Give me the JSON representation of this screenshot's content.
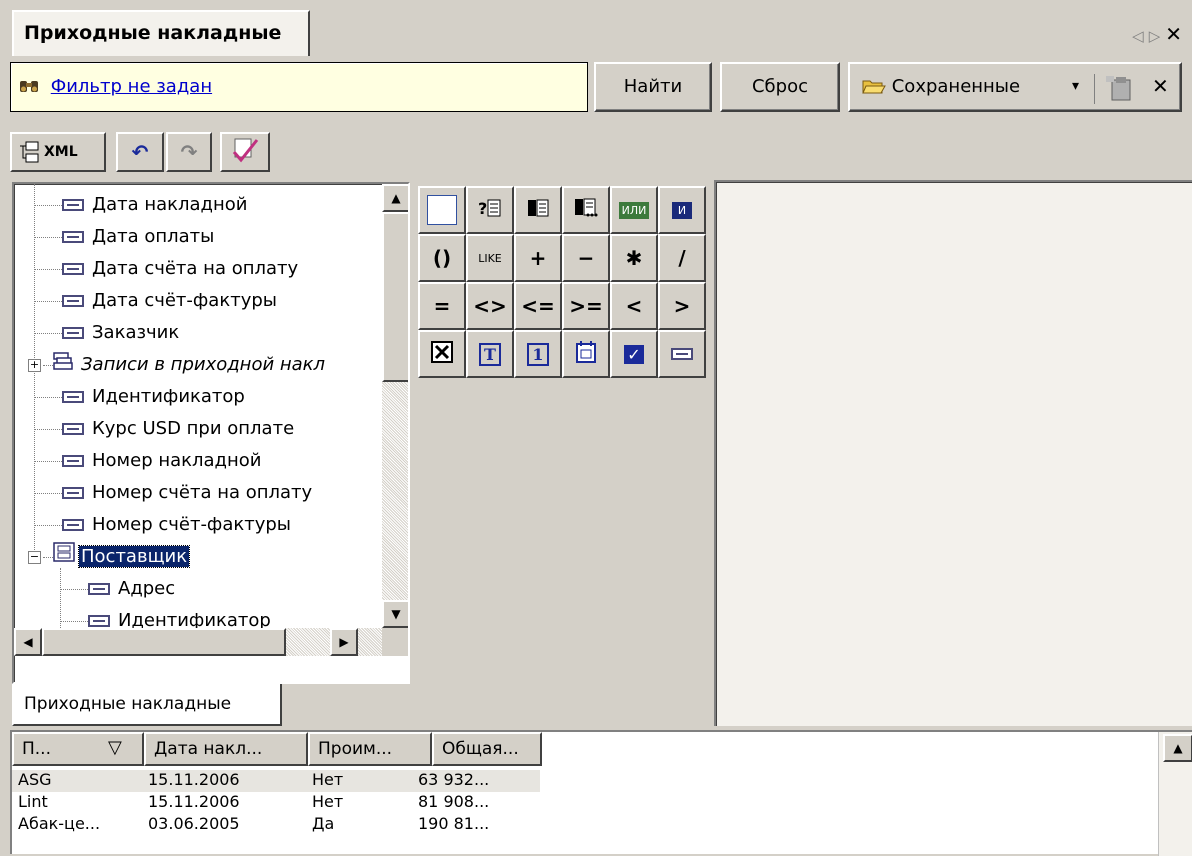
{
  "tab": {
    "title": "Приходные накладные",
    "nav_prev": "◁",
    "nav_next": "▷",
    "close": "✕"
  },
  "filter": {
    "text": "Фильтр не задан",
    "find_label": "Найти",
    "reset_label": "Сброс",
    "saved_label": "Сохраненные",
    "dropdown_arrow": "▾",
    "close": "✕"
  },
  "toolbar": {
    "xml_label": "XML",
    "undo": "↶",
    "redo": "↷"
  },
  "tree": {
    "items": [
      {
        "label": "Дата накладной"
      },
      {
        "label": "Дата оплаты"
      },
      {
        "label": "Дата счёта на оплату"
      },
      {
        "label": "Дата счёт-фактуры"
      },
      {
        "label": "Заказчик"
      },
      {
        "label": "Записи в приходной накл"
      },
      {
        "label": "Идентификатор"
      },
      {
        "label": "Курс USD при оплате"
      },
      {
        "label": "Номер накладной"
      },
      {
        "label": "Номер счёта на оплату"
      },
      {
        "label": "Номер счёт-фактуры"
      },
      {
        "label": "Поставщик"
      },
      {
        "label": "Адрес"
      },
      {
        "label": "Идентификатор"
      }
    ],
    "expand_plus": "+",
    "expand_minus": "−"
  },
  "panel_tab": "Приходные накладные",
  "palette": {
    "or": "ИЛИ",
    "and": "И",
    "parens": "()",
    "like": "LIKE",
    "plus": "+",
    "minus": "−",
    "mul": "✱",
    "div": "/",
    "eq": "=",
    "neq": "<>",
    "lte": "<=",
    "gte": ">=",
    "lt": "<",
    "gt": ">",
    "text_const": "T",
    "num_const": "1",
    "bool_const": "✓"
  },
  "grid": {
    "columns": [
      "П...",
      "Дата накл...",
      "Проим...",
      "Общая..."
    ],
    "sort_icon": "▽",
    "rows": [
      [
        "ASG",
        "15.11.2006",
        "Нет",
        "63 932..."
      ],
      [
        "Lint",
        "15.11.2006",
        "Нет",
        "81 908..."
      ],
      [
        "Абак-це...",
        "03.06.2005",
        "Да",
        "190 81..."
      ]
    ]
  }
}
